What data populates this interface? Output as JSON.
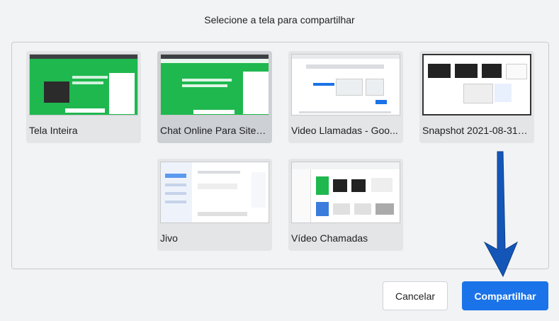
{
  "dialog": {
    "title": "Selecione a tela para compartilhar",
    "cancel_label": "Cancelar",
    "share_label": "Compartilhar",
    "accent": "#1a73e8"
  },
  "sources": [
    {
      "label": "Tela Inteira",
      "selected": false
    },
    {
      "label": "Chat Online Para Sites |...",
      "selected": true
    },
    {
      "label": "Video Llamadas - Goo...",
      "selected": false
    },
    {
      "label": "Snapshot 2021-08-31 0...",
      "selected": false
    },
    {
      "label": "Jivo",
      "selected": false
    },
    {
      "label": "Vídeo Chamadas",
      "selected": false
    }
  ],
  "annotation": {
    "arrow_color": "#1456b8"
  }
}
